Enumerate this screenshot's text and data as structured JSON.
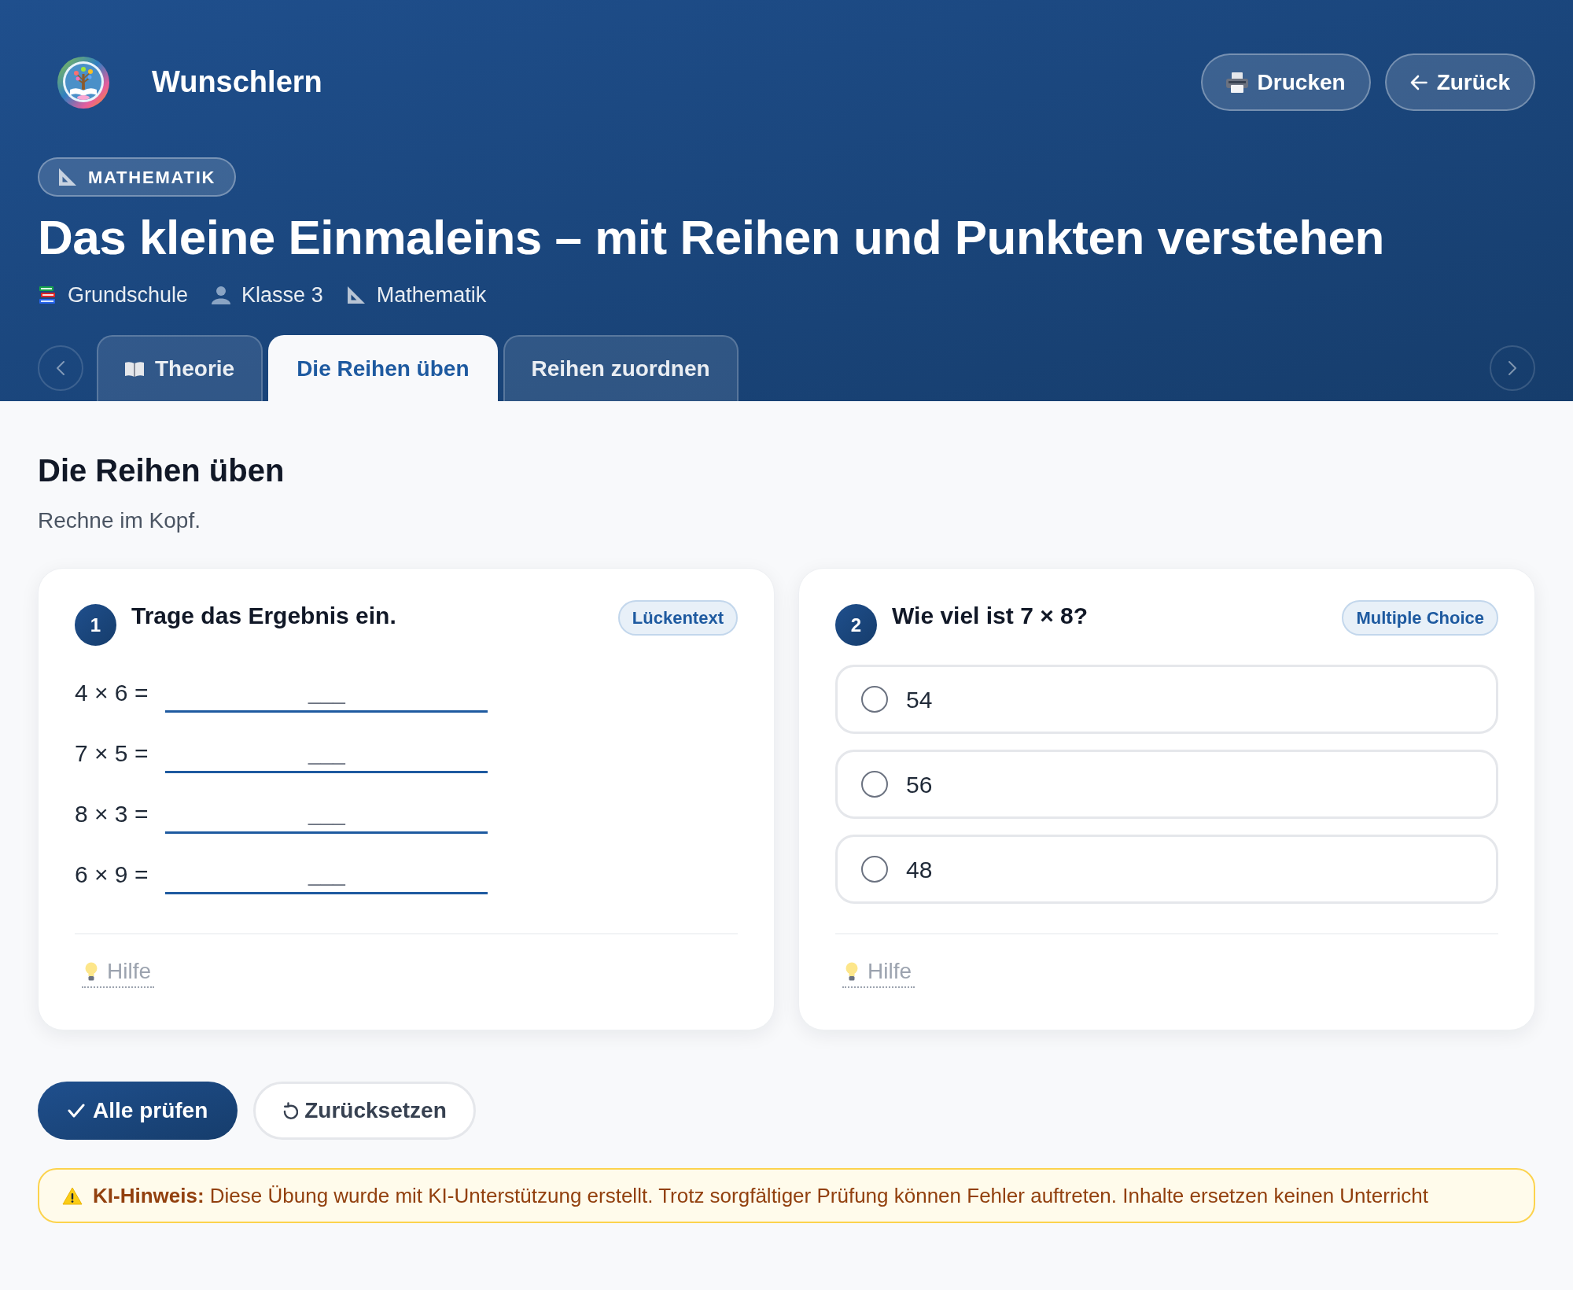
{
  "header": {
    "brand": "Wunschlern",
    "actions": [
      {
        "kind": "print",
        "label": "Drucken"
      },
      {
        "kind": "back",
        "label": "Zurück"
      }
    ]
  },
  "subject_badge": "MATHEMATIK",
  "title": "Das kleine Einmaleins – mit Reihen und Punkten verstehen",
  "meta": [
    {
      "kind": "school",
      "text": "Grundschule"
    },
    {
      "kind": "grade",
      "text": "Klasse 3"
    },
    {
      "kind": "subject",
      "text": "Mathematik"
    }
  ],
  "tabs": [
    {
      "kind": "theory",
      "label": "Theorie",
      "selected": false
    },
    {
      "kind": "exercise",
      "label": "Die Reihen üben",
      "selected": true
    },
    {
      "kind": "exercise",
      "label": "Reihen zuordnen",
      "selected": false
    }
  ],
  "section": {
    "title": "Die Reihen üben",
    "subtitle": "Rechne im Kopf."
  },
  "questions": [
    {
      "kind": "gap",
      "number": "1",
      "prompt": "Trage das Ergebnis ein.",
      "type_label": "Lückentext",
      "gaps": [
        {
          "label": "4 × 6 =",
          "placeholder": "___"
        },
        {
          "label": "7 × 5 =",
          "placeholder": "___"
        },
        {
          "label": "8 × 3 =",
          "placeholder": "___"
        },
        {
          "label": "6 × 9 =",
          "placeholder": "___"
        }
      ],
      "help": "Hilfe"
    },
    {
      "kind": "choice",
      "number": "2",
      "prompt": "Wie viel ist 7 × 8?",
      "type_label": "Multiple Choice",
      "options": [
        {
          "label": "54",
          "selected": false
        },
        {
          "label": "56",
          "selected": false
        },
        {
          "label": "48",
          "selected": false
        }
      ],
      "help": "Hilfe"
    }
  ],
  "actions": [
    {
      "kind": "check",
      "label": "Alle prüfen"
    },
    {
      "kind": "reset",
      "label": "Zurücksetzen"
    }
  ],
  "notice": "**KI-Hinweis:** Diese Übung wurde mit KI-Unterstützung erstellt. Trotz sorgfältiger Prüfung können Fehler auftreten. Inhalte ersetzen keinen Unterricht"
}
